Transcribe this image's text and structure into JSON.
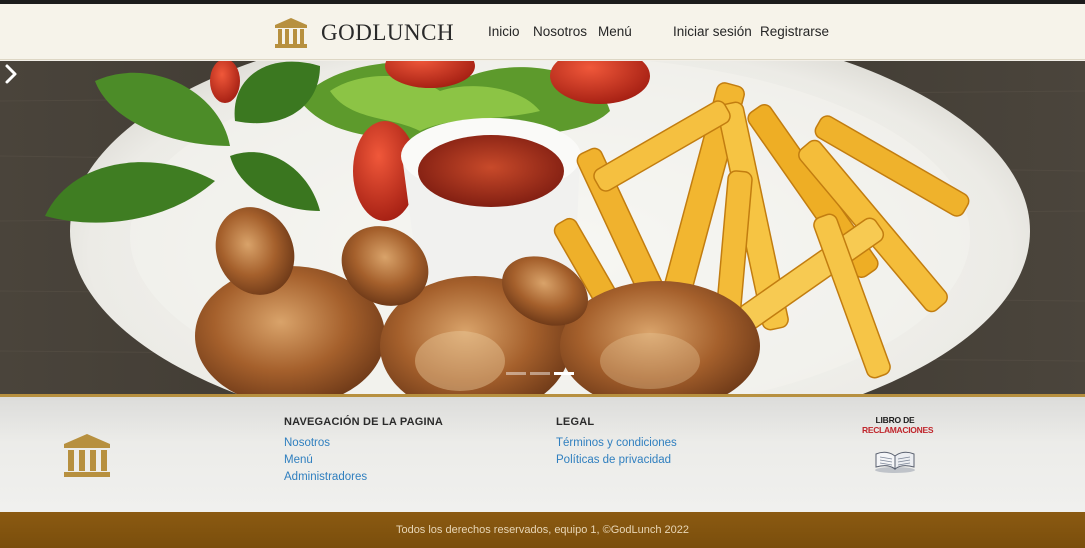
{
  "brand": {
    "name": "GODLUNCH",
    "logo_icon": "column-temple-icon"
  },
  "nav": {
    "inicio": "Inicio",
    "nosotros": "Nosotros",
    "menu": "Menú",
    "login": "Iniciar sesión",
    "register": "Registrarse"
  },
  "hero": {
    "image": "chicken-fries-plate-image",
    "next_icon": "chevron-right-icon",
    "slides": 3,
    "active_slide": 3
  },
  "footer": {
    "nav_title": "NAVEGACIÓN DE LA PAGINA",
    "nav_links": [
      "Nosotros",
      "Menú",
      "Administradores"
    ],
    "legal_title": "LEGAL",
    "legal_links": [
      "Términos y condiciones",
      "Políticas de privacidad"
    ],
    "libro_line1": "LIBRO DE",
    "libro_line2": "RECLAMACIONES",
    "copyright": "Todos los derechos reservados, equipo 1, ©GodLunch 2022"
  },
  "colors": {
    "accent_gold": "#b7903f",
    "link_blue": "#2f7fbf",
    "footer_bar": "#7a4e0c",
    "reclamaciones_red": "#c0262c"
  }
}
